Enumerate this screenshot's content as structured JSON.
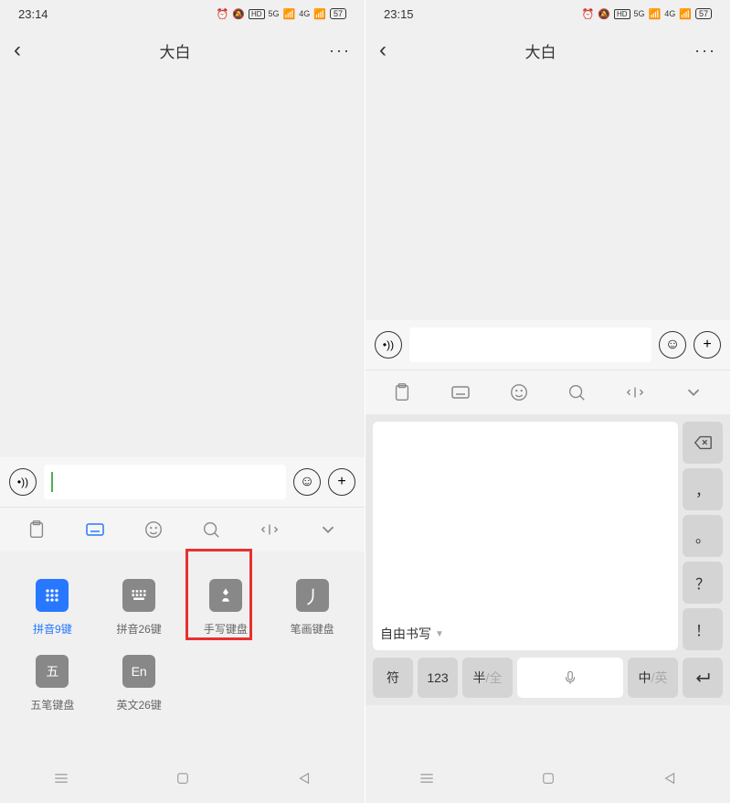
{
  "left": {
    "status": {
      "time": "23:14",
      "battery": "57"
    },
    "nav": {
      "title": "大白"
    },
    "toolbar": {
      "items": [
        "clipboard",
        "keyboard",
        "emoji",
        "search",
        "cursor",
        "collapse"
      ]
    },
    "keyboards": [
      {
        "icon": "⠿",
        "label": "拼音9键",
        "active": true
      },
      {
        "icon": "⌨",
        "label": "拼音26键",
        "active": false
      },
      {
        "icon": "✋",
        "label": "手写键盘",
        "active": false
      },
      {
        "icon": "丿",
        "label": "笔画键盘",
        "active": false
      },
      {
        "icon": "五",
        "label": "五笔键盘",
        "active": false
      },
      {
        "icon": "En",
        "label": "英文26键",
        "active": false
      }
    ]
  },
  "right": {
    "status": {
      "time": "23:15",
      "battery": "57"
    },
    "nav": {
      "title": "大白"
    },
    "hw": {
      "mode": "自由书写",
      "side_keys": [
        "⌫",
        "，",
        "。",
        "？",
        "！"
      ],
      "bottom": {
        "sym": "符",
        "num": "123",
        "half_full": {
          "a": "半",
          "b": "/全"
        },
        "space": "mic",
        "lang": {
          "a": "中",
          "b": "/英"
        },
        "enter": "↵"
      }
    }
  }
}
